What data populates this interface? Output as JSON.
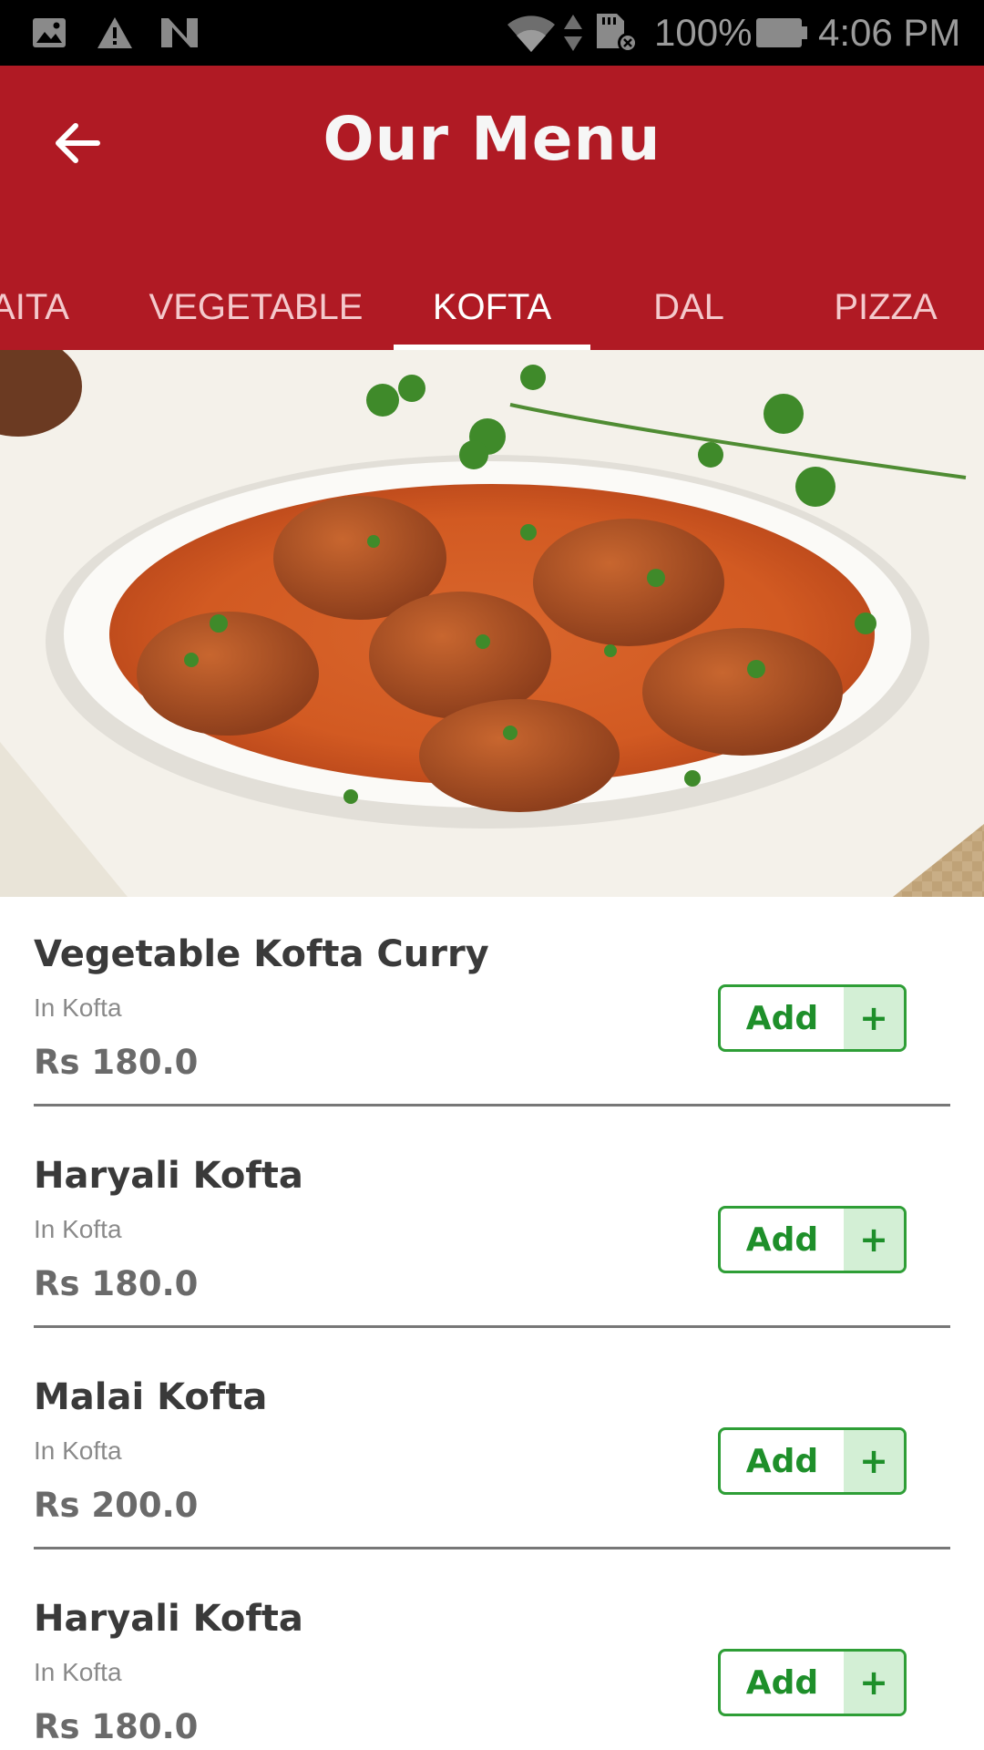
{
  "status_bar": {
    "left_icons": [
      "image-icon",
      "warning-icon",
      "n-icon"
    ],
    "right_icons": [
      "wifi-icon",
      "data-arrows-icon",
      "sd-card-icon",
      "battery-icon"
    ],
    "battery": "100%",
    "time": "4:06 PM"
  },
  "app_bar": {
    "title": "Our Menu",
    "back_icon": "arrow-left-icon",
    "color": "#b01a24"
  },
  "tabs": [
    {
      "label": "AITA",
      "active": false
    },
    {
      "label": "VEGETABLE",
      "active": false
    },
    {
      "label": "KOFTA",
      "active": true
    },
    {
      "label": "DAL",
      "active": false
    },
    {
      "label": "PIZZA",
      "active": false
    }
  ],
  "hero_image": {
    "subject": "kofta-curry-bowl",
    "icon": "kofta-curry-image"
  },
  "menu_items": [
    {
      "name": "Vegetable Kofta Curry",
      "category": "In Kofta",
      "price": "Rs 180.0",
      "add_label": "Add",
      "plus": "+"
    },
    {
      "name": "Haryali Kofta",
      "category": "In Kofta",
      "price": "Rs 180.0",
      "add_label": "Add",
      "plus": "+"
    },
    {
      "name": "Malai Kofta",
      "category": "In Kofta",
      "price": "Rs 200.0",
      "add_label": "Add",
      "plus": "+"
    },
    {
      "name": "Haryali Kofta",
      "category": "In Kofta",
      "price": "Rs 180.0",
      "add_label": "Add",
      "plus": "+"
    }
  ],
  "colors": {
    "accent": "#b01a24",
    "add_green": "#2e9e36",
    "add_green_light": "#d3efd5"
  }
}
